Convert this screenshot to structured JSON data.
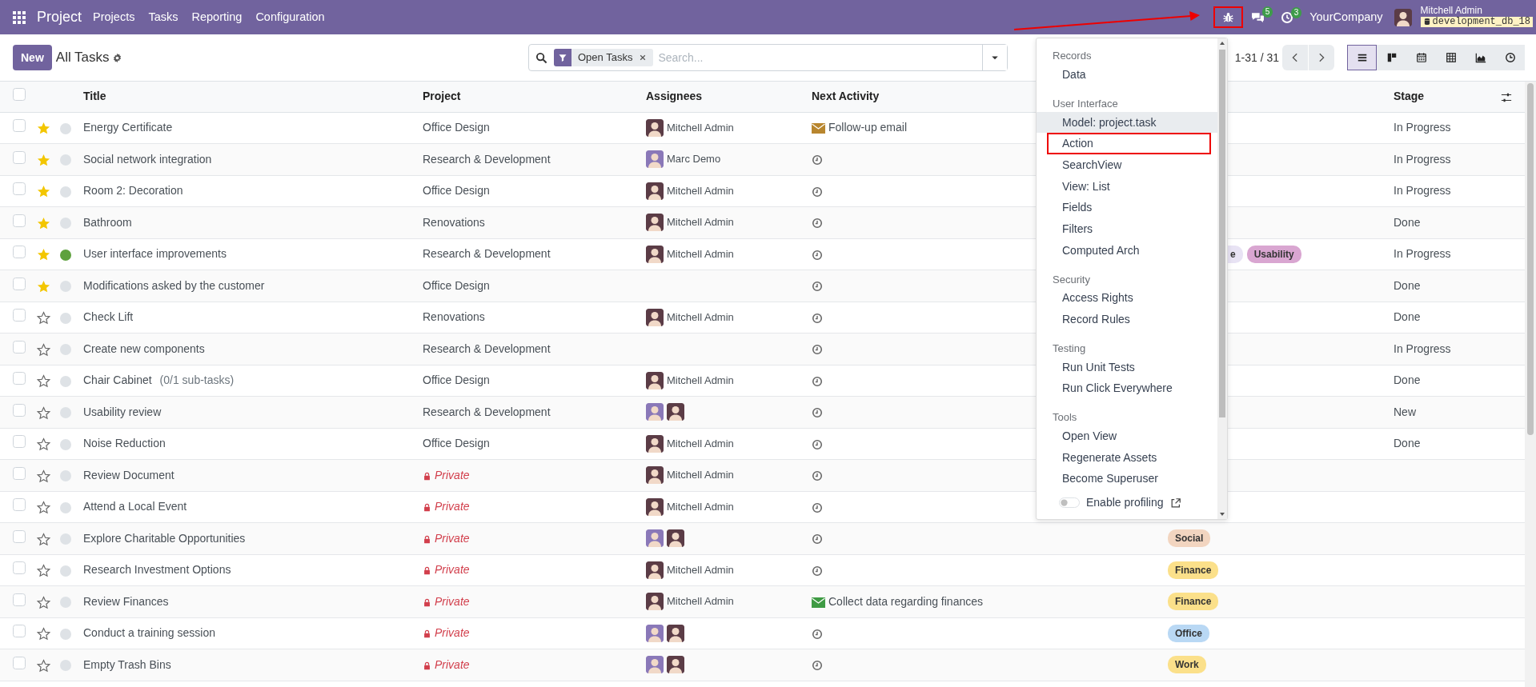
{
  "navbar": {
    "app_name": "Project",
    "menus": [
      "Projects",
      "Tasks",
      "Reporting",
      "Configuration"
    ],
    "debug_highlighted": true,
    "messages_count": "5",
    "activities_count": "3",
    "company": "YourCompany",
    "user_name": "Mitchell Admin",
    "database": "development_db_18"
  },
  "annotation_arrow": true,
  "control_panel": {
    "new_button": "New",
    "title": "All Tasks",
    "search": {
      "facets": [
        "Open Tasks"
      ],
      "placeholder": "Search..."
    },
    "pager": "1-31 / 31",
    "views": [
      {
        "kind": "list",
        "selected": true
      },
      {
        "kind": "kanban",
        "selected": false
      },
      {
        "kind": "calendar",
        "selected": false
      },
      {
        "kind": "pivot",
        "selected": false
      },
      {
        "kind": "graph",
        "selected": false
      },
      {
        "kind": "activity",
        "selected": false
      }
    ]
  },
  "table": {
    "all_checked": false,
    "columns": [
      "Title",
      "Project",
      "Assignees",
      "Next Activity",
      "Stage"
    ],
    "rows": [
      {
        "checked": false,
        "starred": true,
        "status": {
          "color": "#dee2e6"
        },
        "title": "Energy Certificate",
        "project": "Office Design",
        "private": false,
        "assignees": [
          {
            "name": "Mitchell Admin",
            "color": "#5b3c46"
          }
        ],
        "activity": {
          "kind": "email",
          "label": "Follow-up email",
          "color": "#b8862e"
        },
        "tags": [],
        "stage": "In Progress"
      },
      {
        "checked": false,
        "starred": true,
        "status": {
          "color": "#dee2e6"
        },
        "title": "Social network integration",
        "project": "Research & Development",
        "private": false,
        "assignees": [
          {
            "name": "Marc Demo",
            "color": "#8a78b8"
          }
        ],
        "activity": {
          "kind": "none"
        },
        "tags": [],
        "stage": "In Progress"
      },
      {
        "checked": false,
        "starred": true,
        "status": {
          "color": "#dee2e6"
        },
        "title": "Room 2: Decoration",
        "project": "Office Design",
        "private": false,
        "assignees": [
          {
            "name": "Mitchell Admin",
            "color": "#5b3c46"
          }
        ],
        "activity": {
          "kind": "none"
        },
        "tags": [],
        "stage": "In Progress"
      },
      {
        "checked": false,
        "starred": true,
        "status": {
          "color": "#dee2e6"
        },
        "title": "Bathroom",
        "project": "Renovations",
        "private": false,
        "assignees": [
          {
            "name": "Mitchell Admin",
            "color": "#5b3c46"
          }
        ],
        "activity": {
          "kind": "none"
        },
        "tags": [],
        "stage": "Done"
      },
      {
        "checked": false,
        "starred": true,
        "status": {
          "color": "#5ea13e"
        },
        "title": "User interface improvements",
        "project": "Research & Development",
        "private": false,
        "assignees": [
          {
            "name": "Mitchell Admin",
            "color": "#5b3c46"
          }
        ],
        "activity": {
          "kind": "none"
        },
        "tags": [
          {
            "label": "e",
            "color": "#e8e3f4",
            "clipped": true
          },
          {
            "label": "Usability",
            "color": "#d9a6d1",
            "clipped": false
          }
        ],
        "stage": "In Progress"
      },
      {
        "checked": false,
        "starred": true,
        "status": {
          "color": "#dee2e6"
        },
        "title": "Modifications asked by the customer",
        "project": "Office Design",
        "private": false,
        "assignees": [],
        "activity": {
          "kind": "none"
        },
        "tags": [],
        "stage": "Done"
      },
      {
        "checked": false,
        "starred": false,
        "status": {
          "color": "#dee2e6"
        },
        "title": "Check Lift",
        "project": "Renovations",
        "private": false,
        "assignees": [
          {
            "name": "Mitchell Admin",
            "color": "#5b3c46"
          }
        ],
        "activity": {
          "kind": "none"
        },
        "tags": [],
        "stage": "Done"
      },
      {
        "checked": false,
        "starred": false,
        "status": {
          "color": "#dee2e6"
        },
        "title": "Create new components",
        "project": "Research & Development",
        "private": false,
        "assignees": [],
        "activity": {
          "kind": "none"
        },
        "tags": [],
        "stage": "In Progress"
      },
      {
        "checked": false,
        "starred": false,
        "status": {
          "color": "#dee2e6"
        },
        "title": "Chair Cabinet",
        "subtasks": "(0/1 sub-tasks)",
        "project": "Office Design",
        "private": false,
        "assignees": [
          {
            "name": "Mitchell Admin",
            "color": "#5b3c46"
          }
        ],
        "activity": {
          "kind": "none"
        },
        "tags": [],
        "stage": "Done"
      },
      {
        "checked": false,
        "starred": false,
        "status": {
          "color": "#dee2e6"
        },
        "title": "Usability review",
        "project": "Research & Development",
        "private": false,
        "assignees": [
          {
            "color": "#8a78b8"
          },
          {
            "color": "#5b3c46"
          }
        ],
        "activity": {
          "kind": "none"
        },
        "tags": [],
        "stage": "New"
      },
      {
        "checked": false,
        "starred": false,
        "status": {
          "color": "#dee2e6"
        },
        "title": "Noise Reduction",
        "project": "Office Design",
        "private": false,
        "assignees": [
          {
            "name": "Mitchell Admin",
            "color": "#5b3c46"
          }
        ],
        "activity": {
          "kind": "none"
        },
        "tags": [],
        "stage": "Done"
      },
      {
        "checked": false,
        "starred": false,
        "status": {
          "color": "#dee2e6"
        },
        "title": "Review Document",
        "project": "Private",
        "private": true,
        "assignees": [
          {
            "name": "Mitchell Admin",
            "color": "#5b3c46"
          }
        ],
        "activity": {
          "kind": "none"
        },
        "tags": []
      },
      {
        "checked": false,
        "starred": false,
        "status": {
          "color": "#dee2e6"
        },
        "title": "Attend a Local Event",
        "project": "Private",
        "private": true,
        "assignees": [
          {
            "name": "Mitchell Admin",
            "color": "#5b3c46"
          }
        ],
        "activity": {
          "kind": "none"
        },
        "tags": []
      },
      {
        "checked": false,
        "starred": false,
        "status": {
          "color": "#dee2e6"
        },
        "title": "Explore Charitable Opportunities",
        "project": "Private",
        "private": true,
        "assignees": [
          {
            "color": "#8a78b8"
          },
          {
            "color": "#5b3c46"
          }
        ],
        "activity": {
          "kind": "none"
        },
        "tags": [
          {
            "label": "Social",
            "color": "#f2d5c0",
            "clipped": false
          }
        ]
      },
      {
        "checked": false,
        "starred": false,
        "status": {
          "color": "#dee2e6"
        },
        "title": "Research Investment Options",
        "project": "Private",
        "private": true,
        "assignees": [
          {
            "name": "Mitchell Admin",
            "color": "#5b3c46"
          }
        ],
        "activity": {
          "kind": "none"
        },
        "tags": [
          {
            "label": "Finance",
            "color": "#fbe08a",
            "clipped": false
          }
        ]
      },
      {
        "checked": false,
        "starred": false,
        "status": {
          "color": "#dee2e6"
        },
        "title": "Review Finances",
        "project": "Private",
        "private": true,
        "assignees": [
          {
            "name": "Mitchell Admin",
            "color": "#5b3c46"
          }
        ],
        "activity": {
          "kind": "email",
          "label": "Collect data regarding finances",
          "color": "#3f9b44"
        },
        "tags": [
          {
            "label": "Finance",
            "color": "#fbe08a",
            "clipped": false
          }
        ]
      },
      {
        "checked": false,
        "starred": false,
        "status": {
          "color": "#dee2e6"
        },
        "title": "Conduct a training session",
        "project": "Private",
        "private": true,
        "assignees": [
          {
            "color": "#8a78b8"
          },
          {
            "color": "#5b3c46"
          }
        ],
        "activity": {
          "kind": "none"
        },
        "tags": [
          {
            "label": "Office",
            "color": "#b9d8f4",
            "clipped": false
          }
        ]
      },
      {
        "checked": false,
        "starred": false,
        "status": {
          "color": "#dee2e6"
        },
        "title": "Empty Trash Bins",
        "project": "Private",
        "private": true,
        "assignees": [
          {
            "color": "#8a78b8"
          },
          {
            "color": "#5b3c46"
          }
        ],
        "activity": {
          "kind": "none"
        },
        "tags": [
          {
            "label": "Work",
            "color": "#fbe08a",
            "clipped": false
          }
        ]
      }
    ]
  },
  "debug_menu": {
    "sections": [
      {
        "title": "Records",
        "items": [
          {
            "label": "Data",
            "hovered": false,
            "highlighted": false
          }
        ]
      },
      {
        "title": "User Interface",
        "items": [
          {
            "label": "Model: project.task",
            "hovered": true,
            "highlighted": false
          },
          {
            "label": "Action",
            "hovered": false,
            "highlighted": true
          },
          {
            "label": "SearchView",
            "hovered": false,
            "highlighted": false
          },
          {
            "label": "View: List",
            "hovered": false,
            "highlighted": false
          },
          {
            "label": "Fields",
            "hovered": false,
            "highlighted": false
          },
          {
            "label": "Filters",
            "hovered": false,
            "highlighted": false
          },
          {
            "label": "Computed Arch",
            "hovered": false,
            "highlighted": false
          }
        ]
      },
      {
        "title": "Security",
        "items": [
          {
            "label": "Access Rights",
            "hovered": false,
            "highlighted": false
          },
          {
            "label": "Record Rules",
            "hovered": false,
            "highlighted": false
          }
        ]
      },
      {
        "title": "Testing",
        "items": [
          {
            "label": "Run Unit Tests",
            "hovered": false,
            "highlighted": false
          },
          {
            "label": "Run Click Everywhere",
            "hovered": false,
            "highlighted": false
          }
        ]
      },
      {
        "title": "Tools",
        "items": [
          {
            "label": "Open View",
            "hovered": false,
            "highlighted": false
          },
          {
            "label": "Regenerate Assets",
            "hovered": false,
            "highlighted": false
          },
          {
            "label": "Become Superuser",
            "hovered": false,
            "highlighted": false
          }
        ]
      }
    ],
    "profiling": {
      "label": "Enable profiling",
      "on": false
    }
  }
}
